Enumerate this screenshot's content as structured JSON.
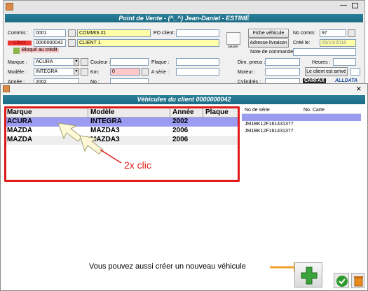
{
  "bg_window": {
    "title": "Point de Vente - (^_^) Jean-Daniel - ESTIMÉ",
    "commis_label": "Commis :",
    "commis_code": "0001",
    "commis_name": "COMMIS #1",
    "client_label": "Client",
    "client_code": "0000000042",
    "client_name": "CLIENT 1",
    "blocked_badge": "Bloqué au crédit",
    "po_label": "PO client:",
    "fiche_button": "Fiche véhicule",
    "adresse_button": "Adresse livraison",
    "sauver_label": "sauver",
    "no_comm_label": "No comm:",
    "no_comm_value": "97",
    "cree_le_label": "Créé le:",
    "cree_le_value": "05/10/2016",
    "note_label": "Note de commande",
    "marque_label": "Marque :",
    "marque_value": "ACURA",
    "modele_label": "Modèle :",
    "modele_value": "INTEGRA",
    "annee_label": "Année :",
    "annee_value": "2002",
    "couleur_label": "Couleur :",
    "km_label": "Km:",
    "km_value": "0",
    "no_label": "No :",
    "plaque_label": "Plaque :",
    "serie_label": "# série :",
    "cylindres_label": "Cylindrés :",
    "dim_pneus_label": "Dim. pneus :",
    "moteur_label": "Moteur :",
    "heures_label": "Heures :",
    "client_arrive_button": "Le client est arrivé",
    "carfax_label": "CARFAX",
    "alldata_label": "ALLDATA"
  },
  "dialog": {
    "title": "Véhicules du client 0000000042",
    "columns": [
      "Marque",
      "Modèle",
      "Année",
      "Plaque"
    ],
    "rows": [
      {
        "marque": "ACURA",
        "modele": "INTEGRA",
        "annee": "2002",
        "plaque": ""
      },
      {
        "marque": "MAZDA",
        "modele": "MAZDA3",
        "annee": "2006",
        "plaque": ""
      },
      {
        "marque": "MAZDA",
        "modele": "MAZDA3",
        "annee": "2006",
        "plaque": ""
      }
    ],
    "right_columns": [
      "No de série",
      "No. Carte"
    ],
    "right_rows": [
      {
        "serie": "",
        "carte": ""
      },
      {
        "serie": "JM1BK12F161431377",
        "carte": ""
      },
      {
        "serie": "JM1BK12F161431377",
        "carte": ""
      }
    ],
    "close_symbol": "×"
  },
  "annotations": {
    "double_click": "2x clic",
    "create_new": "Vous pouvez aussi créer un nouveau véhicule"
  },
  "colors": {
    "teal": "#1f6f88",
    "highlight": "#9b9bf2",
    "annotation_red": "#e11b1b",
    "add_green": "#3ca33c"
  }
}
